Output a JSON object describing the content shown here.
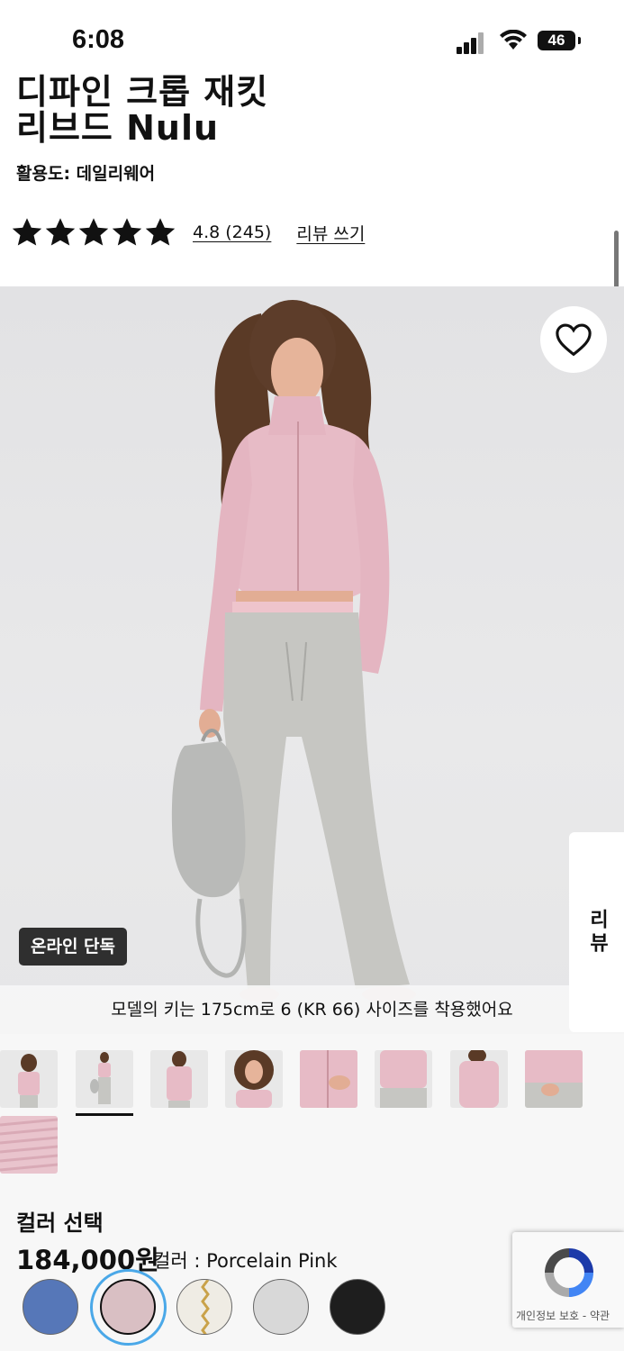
{
  "status_bar": {
    "time": "6:08",
    "battery": "46"
  },
  "product": {
    "title_line1": "디파인 크롭 재킷",
    "title_line2": "리브드 Nulu",
    "activity": "활용도: 데일리웨어",
    "rating_text": "4.8 (245)",
    "stars": 5,
    "write_review": "리뷰 쓰기"
  },
  "gallery": {
    "badge": "온라인 단독",
    "model_caption": "모델의 키는 175cm로 6 (KR 66) 사이즈를 착용했어요",
    "review_tab": "리뷰",
    "thumbnail_count": 9,
    "selected_thumbnail": 2
  },
  "color": {
    "label": "컬러 선택",
    "price": "184,000원",
    "color_caption": "컬러 : Porcelain Pink",
    "swatches": [
      {
        "name": "blue",
        "color": "#5677b8"
      },
      {
        "name": "porcelain-pink",
        "color": "#d9bfc3",
        "selected": true
      },
      {
        "name": "cream-zip",
        "color": "#efece4"
      },
      {
        "name": "light-grey",
        "color": "#d8d8d8"
      },
      {
        "name": "black",
        "color": "#1e1e1e"
      }
    ]
  },
  "recaptcha": {
    "text": "개인정보 보호 - 약관"
  },
  "colors": {
    "accent_ring": "#4aa8e8",
    "badge_bg": "#2f2f2f",
    "jacket_pink": "#e5b9c4",
    "pants_grey": "#c7c7c3"
  }
}
